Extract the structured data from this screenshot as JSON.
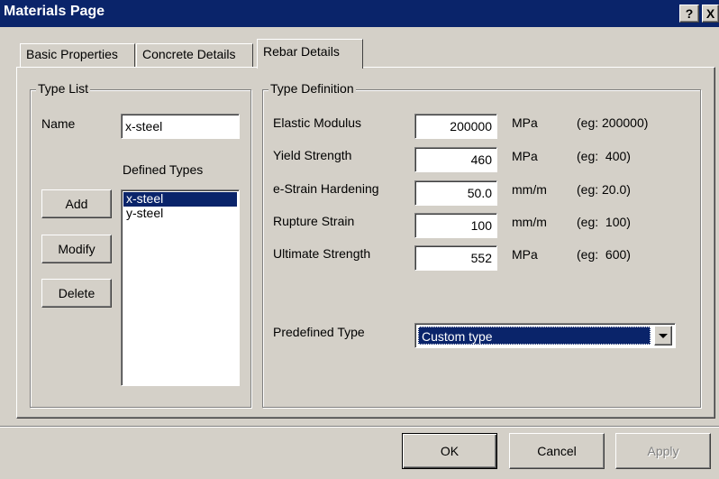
{
  "window": {
    "title": "Materials Page",
    "help_label": "?",
    "close_label": "X"
  },
  "tabs": [
    {
      "label": "Basic Properties",
      "active": false
    },
    {
      "label": "Concrete Details",
      "active": false
    },
    {
      "label": "Rebar Details",
      "active": true
    }
  ],
  "type_list": {
    "group_label": "Type List",
    "name_label": "Name",
    "name_value": "x-steel",
    "defined_types_label": "Defined Types",
    "items": [
      "x-steel",
      "y-steel"
    ],
    "selected": "x-steel",
    "buttons": {
      "add": "Add",
      "modify": "Modify",
      "delete": "Delete"
    }
  },
  "type_definition": {
    "group_label": "Type Definition",
    "rows": [
      {
        "label": "Elastic Modulus",
        "value": "200000",
        "unit": "MPa",
        "example": "(eg: 200000)"
      },
      {
        "label": "Yield Strength",
        "value": "460",
        "unit": "MPa",
        "example": "(eg:  400)"
      },
      {
        "label": "e-Strain Hardening",
        "value": "50.0",
        "unit": "mm/m",
        "example": "(eg: 20.0)"
      },
      {
        "label": "Rupture Strain",
        "value": "100",
        "unit": "mm/m",
        "example": "(eg:  100)"
      },
      {
        "label": "Ultimate Strength",
        "value": "552",
        "unit": "MPa",
        "example": "(eg:  600)"
      }
    ],
    "predefined_label": "Predefined Type",
    "predefined_value": "Custom type"
  },
  "dialog_buttons": {
    "ok": "OK",
    "cancel": "Cancel",
    "apply": "Apply"
  },
  "colors": {
    "title_bar": "#0a246a",
    "face": "#d4d0c8",
    "selection": "#0a246a"
  }
}
